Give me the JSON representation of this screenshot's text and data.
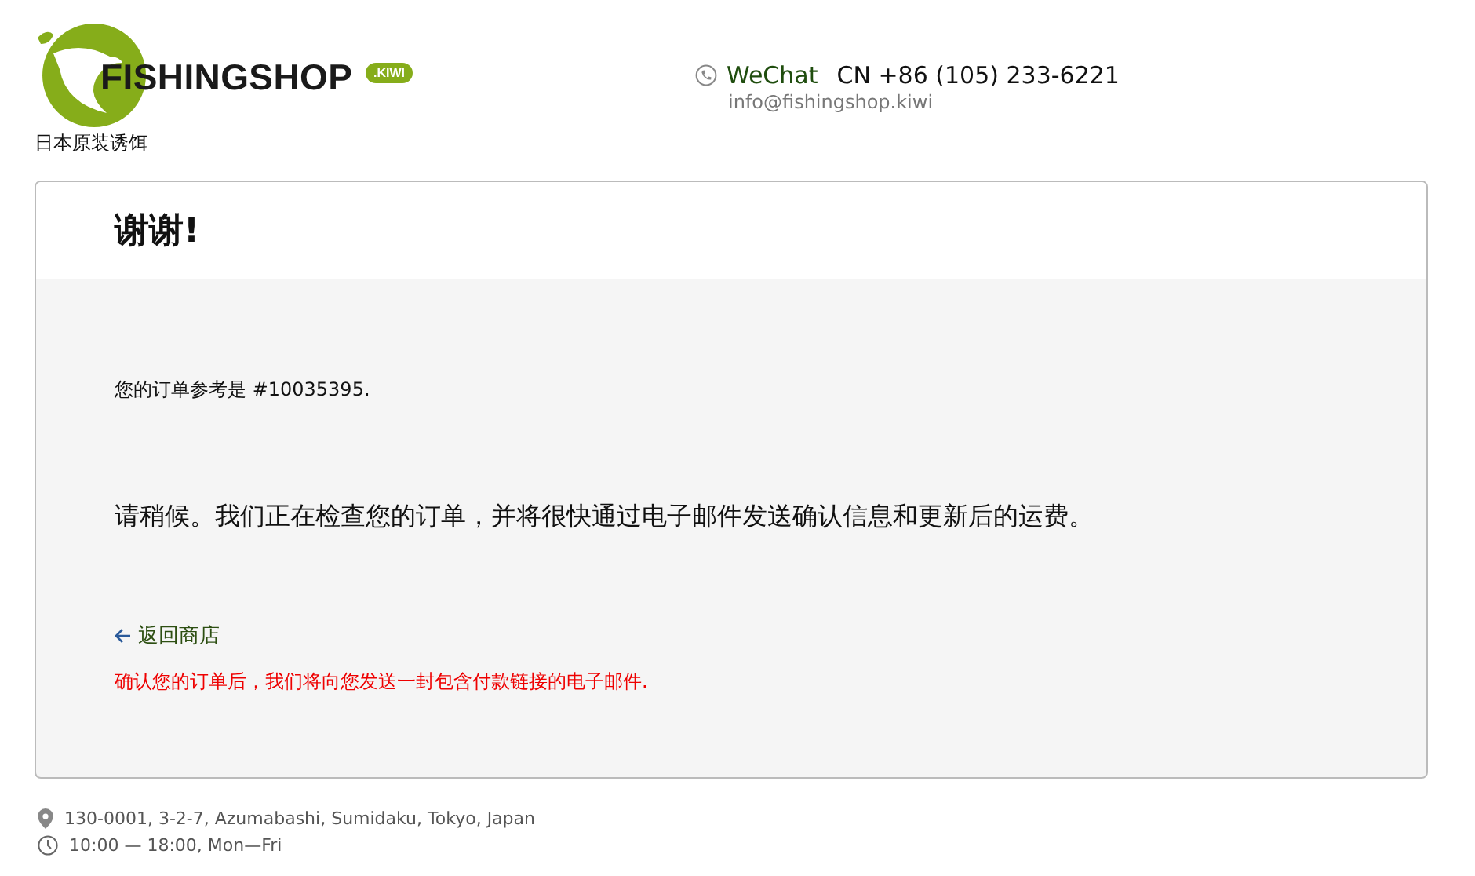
{
  "logo": {
    "name": "FISHINGSHOP",
    "badge": ".KIWI",
    "tagline": "日本原装诱饵"
  },
  "contact": {
    "wechat": "WeChat",
    "phone": "CN +86 (105) 233-6221",
    "email": "info@fishingshop.kiwi"
  },
  "card": {
    "title": "谢谢!",
    "reference": "您的订单参考是 #10035395.",
    "message": "请稍候。我们正在检查您的订单，并将很快通过电子邮件发送确认信息和更新后的运费。",
    "back_link": "返回商店",
    "notice": "确认您的订单后，我们将向您发送一封包含付款链接的电子邮件."
  },
  "footer": {
    "address": "130-0001, 3-2-7, Azumabashi, Sumidaku, Tokyo, Japan",
    "hours": "10:00 — 18:00, Mon—Fri"
  }
}
